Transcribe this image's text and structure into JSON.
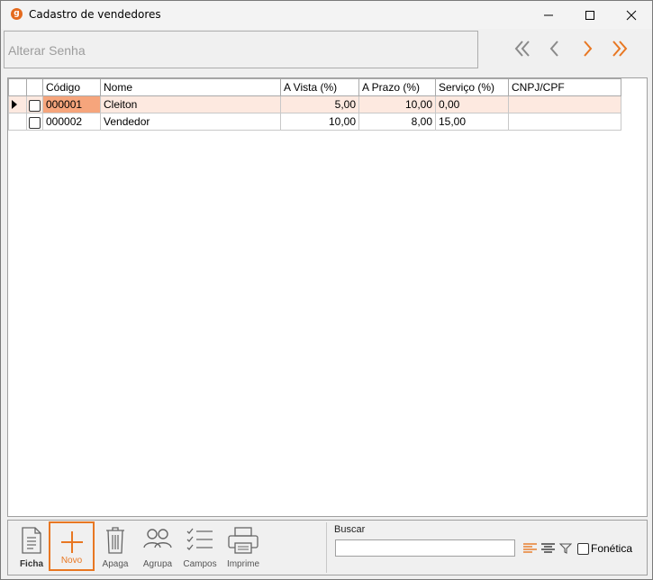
{
  "window": {
    "title": "Cadastro de vendedores",
    "icon_letter": "g",
    "accent_color": "#e87722"
  },
  "top_toolbar": {
    "alterar_senha_label": "Alterar Senha",
    "nav_icons": [
      "first-icon",
      "previous-icon",
      "next-icon",
      "last-icon"
    ]
  },
  "grid": {
    "columns": [
      "Código",
      "Nome",
      "A Vista (%)",
      "A Prazo (%)",
      "Serviço (%)",
      "CNPJ/CPF"
    ],
    "rows": [
      {
        "codigo": "000001",
        "nome": "Cleiton",
        "a_vista": "5,00",
        "a_prazo": "10,00",
        "servico": "0,00",
        "cnpj": "",
        "selected": true,
        "checked": false
      },
      {
        "codigo": "000002",
        "nome": "Vendedor",
        "a_vista": "10,00",
        "a_prazo": "8,00",
        "servico": "15,00",
        "cnpj": "",
        "selected": false,
        "checked": false
      }
    ]
  },
  "bottom_toolbar": {
    "ficha": "Ficha",
    "novo": "Novo",
    "apaga": "Apaga",
    "agrupa": "Agrupa",
    "campos": "Campos",
    "imprime": "Imprime"
  },
  "search": {
    "label": "Buscar",
    "value": "",
    "fonetica_label": "Fonética",
    "fonetica_checked": false
  }
}
